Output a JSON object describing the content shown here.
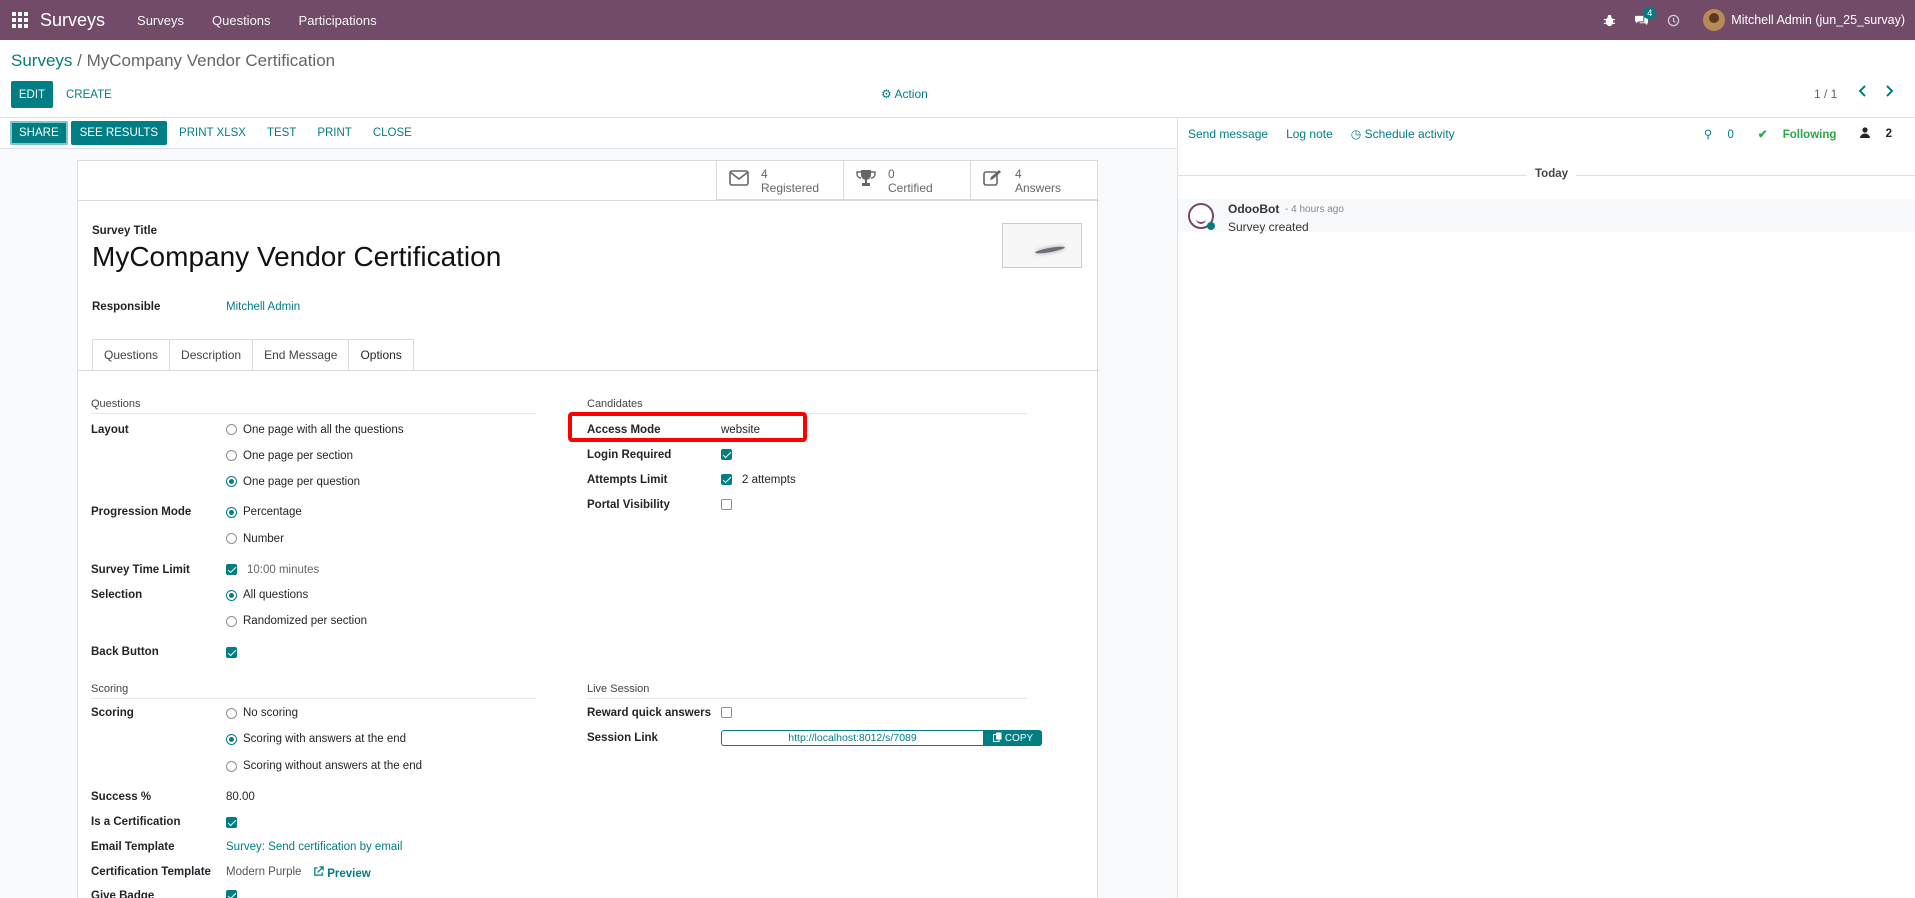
{
  "navbar": {
    "brand": "Surveys",
    "menus": [
      "Surveys",
      "Questions",
      "Participations"
    ],
    "messages_count": "4",
    "user": "Mitchell Admin (jun_25_survay)"
  },
  "breadcrumb": {
    "parent": "Surveys",
    "current": "MyCompany Vendor Certification"
  },
  "control": {
    "edit": "EDIT",
    "create": "CREATE",
    "action": "Action",
    "pager": "1 / 1"
  },
  "statusbar": {
    "share": "SHARE",
    "see_results": "SEE RESULTS",
    "print_xlsx": "PRINT XLSX",
    "test": "TEST",
    "print": "PRINT",
    "close": "CLOSE"
  },
  "stats": [
    {
      "value": "4",
      "label": "Registered",
      "icon": "envelope-icon"
    },
    {
      "value": "0",
      "label": "Certified",
      "icon": "trophy-icon"
    },
    {
      "value": "4",
      "label": "Answers",
      "icon": "edit-icon"
    }
  ],
  "form": {
    "title_label": "Survey Title",
    "title": "MyCompany Vendor Certification",
    "responsible_label": "Responsible",
    "responsible": "Mitchell Admin",
    "tabs": [
      "Questions",
      "Description",
      "End Message",
      "Options"
    ],
    "questions_group": "Questions",
    "layout_label": "Layout",
    "layout_options": [
      "One page with all the questions",
      "One page per section",
      "One page per question"
    ],
    "progression_label": "Progression Mode",
    "progression_options": [
      "Percentage",
      "Number"
    ],
    "time_limit_label": "Survey Time Limit",
    "time_limit": "10:00 minutes",
    "selection_label": "Selection",
    "selection_options": [
      "All questions",
      "Randomized per section"
    ],
    "back_button_label": "Back Button",
    "candidates_group": "Candidates",
    "access_mode_label": "Access Mode",
    "access_mode": "website",
    "login_required_label": "Login Required",
    "attempts_label": "Attempts Limit",
    "attempts": "2 attempts",
    "portal_label": "Portal Visibility",
    "scoring_group": "Scoring",
    "scoring_label": "Scoring",
    "scoring_options": [
      "No scoring",
      "Scoring with answers at the end",
      "Scoring without answers at the end"
    ],
    "success_label": "Success %",
    "success": "80.00",
    "certification_label": "Is a Certification",
    "email_template_label": "Email Template",
    "email_template": "Survey: Send certification by email",
    "cert_template_label": "Certification Template",
    "cert_template": "Modern Purple",
    "preview": "Preview",
    "give_badge_label": "Give Badge",
    "live_group": "Live Session",
    "reward_label": "Reward quick answers",
    "session_link_label": "Session Link",
    "session_link": "http://localhost:8012/s/7089",
    "copy": "COPY"
  },
  "chatter": {
    "send_message": "Send message",
    "log_note": "Log note",
    "schedule_activity": "Schedule activity",
    "attachments": "0",
    "following": "Following",
    "followers": "2",
    "today": "Today",
    "author": "OdooBot",
    "time": "- 4 hours ago",
    "body": "Survey created"
  },
  "colors": {
    "brand": "#714b67",
    "accent": "#017e84",
    "highlight": "#ff0000"
  }
}
